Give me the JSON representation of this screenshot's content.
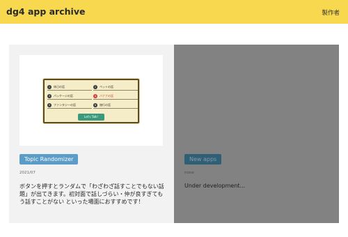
{
  "header": {
    "title": "dg4 app archive",
    "maker_link": "製作者"
  },
  "cards": [
    {
      "thumbnail": {
        "topics": [
          {
            "num": "1",
            "label": "休日の話"
          },
          {
            "num": "2",
            "label": "ペットの話"
          },
          {
            "num": "3",
            "label": "パッケージの話"
          },
          {
            "num": "4",
            "label": "バナナの話"
          },
          {
            "num": "5",
            "label": "ファンタジーの話"
          },
          {
            "num": "6",
            "label": "旅行の話"
          }
        ],
        "button_label": "Let's Talk!"
      },
      "tag": "Topic Randomizer",
      "date": "2021/07",
      "description": "ボタンを押すとランダムで「わざわざ話すことでもない話題」が出てきます。初対面で話しづらい・仲が良すぎてもう話すことがない といった場面におすすめです！"
    },
    {
      "tag": "New apps",
      "date": "none",
      "description": "Under development..."
    }
  ],
  "colors": {
    "header_bg": "#f8d84e",
    "tag_blue": "#5b9cc8",
    "overlay_gray": "#828282",
    "talk_button": "#3b9a7c",
    "highlight_red": "#d04040"
  }
}
